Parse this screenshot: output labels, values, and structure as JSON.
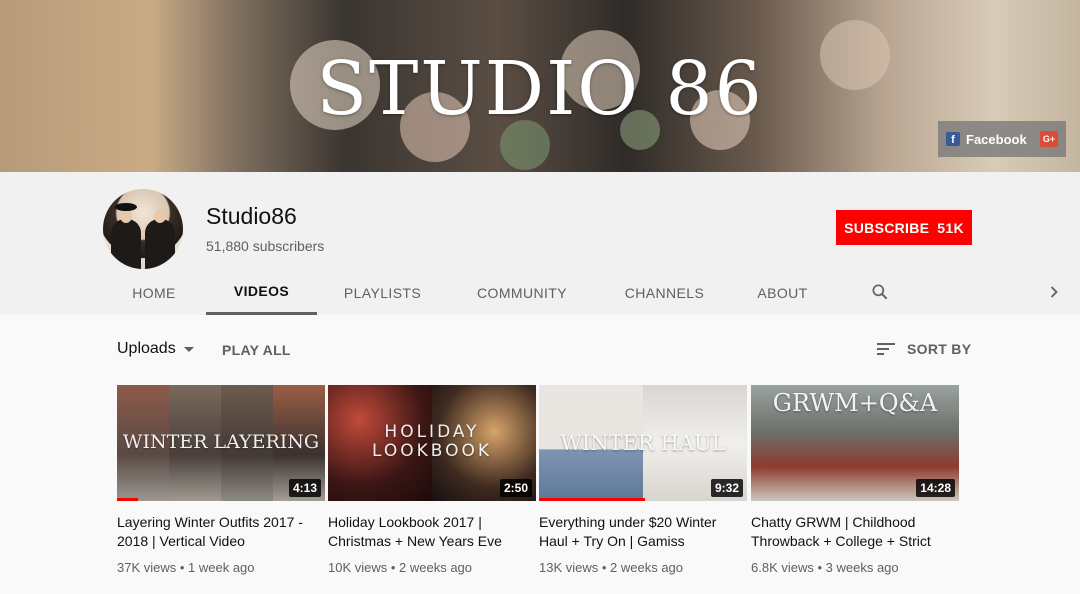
{
  "banner": {
    "title": "STUDIO 86",
    "social": {
      "facebook_label": "Facebook",
      "gplus_label": "G+"
    }
  },
  "channel": {
    "name": "Studio86",
    "subscribers": "51,880 subscribers",
    "subscribe_label": "SUBSCRIBE",
    "subscribe_count": "51K"
  },
  "tabs": [
    {
      "label": "HOME",
      "active": false
    },
    {
      "label": "VIDEOS",
      "active": true
    },
    {
      "label": "PLAYLISTS",
      "active": false
    },
    {
      "label": "COMMUNITY",
      "active": false
    },
    {
      "label": "CHANNELS",
      "active": false
    },
    {
      "label": "ABOUT",
      "active": false
    }
  ],
  "toolbar": {
    "uploads_label": "Uploads",
    "play_all_label": "PLAY ALL",
    "sort_label": "SORT BY"
  },
  "videos": [
    {
      "thumb_text": "WINTER LAYERING",
      "duration": "4:13",
      "watched_fraction": 0.1,
      "title": "Layering Winter Outfits 2017 - 2018 | Vertical Video",
      "meta": "37K views • 1 week ago"
    },
    {
      "thumb_text": "HOLIDAY LOOKBOOK",
      "duration": "2:50",
      "watched_fraction": 0,
      "title": "Holiday Lookbook 2017 | Christmas + New Years Eve",
      "meta": "10K views • 2 weeks ago"
    },
    {
      "thumb_text": "WINTER HAUL",
      "duration": "9:32",
      "watched_fraction": 0.51,
      "title": "Everything under $20 Winter Haul + Try On | Gamiss",
      "meta": "13K views • 2 weeks ago"
    },
    {
      "thumb_text": "GRWM+Q&A",
      "duration": "14:28",
      "watched_fraction": 0,
      "title": "Chatty GRWM | Childhood Throwback + College + Strict",
      "meta": "6.8K views • 3 weeks ago"
    }
  ],
  "colors": {
    "accent": "#ff0000",
    "text_secondary": "#606060"
  },
  "icons": [
    "facebook-icon",
    "google-plus-icon",
    "search-icon",
    "chevron-right-icon",
    "dropdown-caret-icon",
    "sort-icon"
  ]
}
